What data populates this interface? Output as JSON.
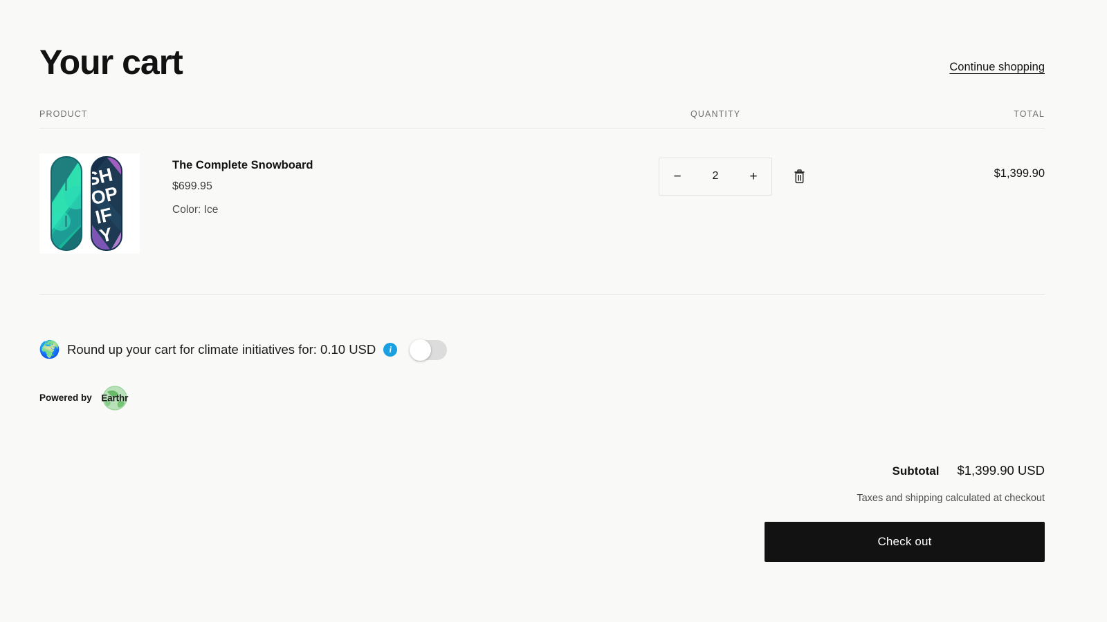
{
  "header": {
    "title": "Your cart",
    "continue_shopping": "Continue shopping"
  },
  "table": {
    "columns": {
      "product": "PRODUCT",
      "quantity": "QUANTITY",
      "total": "TOTAL"
    }
  },
  "items": [
    {
      "name": "The Complete Snowboard",
      "price": "$699.95",
      "variant": "Color: Ice",
      "quantity": "2",
      "decrease_label": "−",
      "increase_label": "+",
      "line_total": "$1,399.90",
      "image_alt": "snowboard-pair"
    }
  ],
  "climate": {
    "emoji": "🌍",
    "message": "Round up your cart for climate initiatives for: 0.10 USD",
    "info_glyph": "i",
    "toggle_state": "off",
    "powered_by_label": "Powered by",
    "brand_name": "Earthr"
  },
  "summary": {
    "subtotal_label": "Subtotal",
    "subtotal_value": "$1,399.90 USD",
    "tax_note": "Taxes and shipping calculated at checkout",
    "checkout_label": "Check out"
  },
  "colors": {
    "background": "#f9f9f8",
    "text": "#121212",
    "muted": "#707070",
    "divider": "#e6e6e4",
    "accent_info": "#1a9fe0",
    "checkout_bg": "#121212"
  }
}
